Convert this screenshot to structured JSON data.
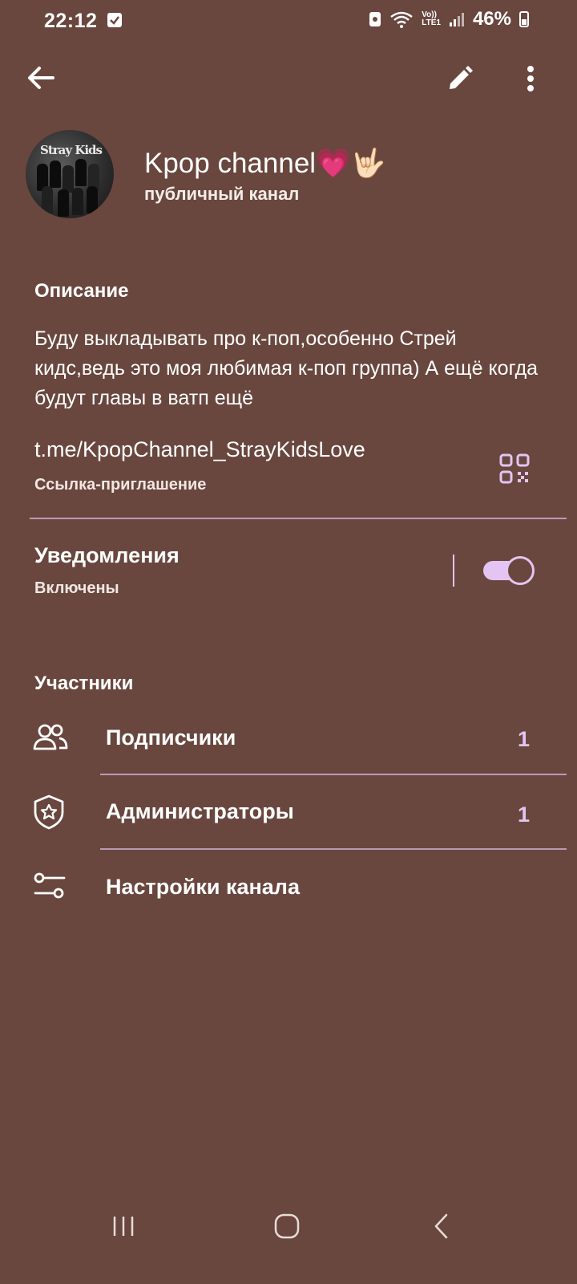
{
  "status_bar": {
    "time": "22:12",
    "network": "LTE1",
    "volte": "Vo))",
    "battery": "46%"
  },
  "header": {
    "back_icon": "arrow-left-icon",
    "edit_icon": "pencil-icon",
    "more_icon": "more-vertical-icon"
  },
  "channel": {
    "name": "Kpop channel💗🤟🏻",
    "subtitle": "публичный канал",
    "avatar_logo": "Stray Kids"
  },
  "description": {
    "title": "Описание",
    "text": "Буду выкладывать про к-поп,особенно Стрей кидс,ведь это моя любимая к-поп группа) А ещё когда будут главы в ватп ещё"
  },
  "invite": {
    "link": "t.me/KpopChannel_StrayKidsLove",
    "label": "Ссылка-приглашение",
    "qr_icon": "qr-code-icon"
  },
  "notifications": {
    "title": "Уведомления",
    "status": "Включены",
    "enabled": true
  },
  "members": {
    "title": "Участники",
    "rows": [
      {
        "label": "Подписчики",
        "count": "1",
        "icon": "users-icon"
      },
      {
        "label": "Администраторы",
        "count": "1",
        "icon": "shield-star-icon"
      },
      {
        "label": "Настройки канала",
        "count": "",
        "icon": "sliders-icon"
      }
    ]
  },
  "colors": {
    "background": "#69473e",
    "accent": "#e3c4f2"
  }
}
